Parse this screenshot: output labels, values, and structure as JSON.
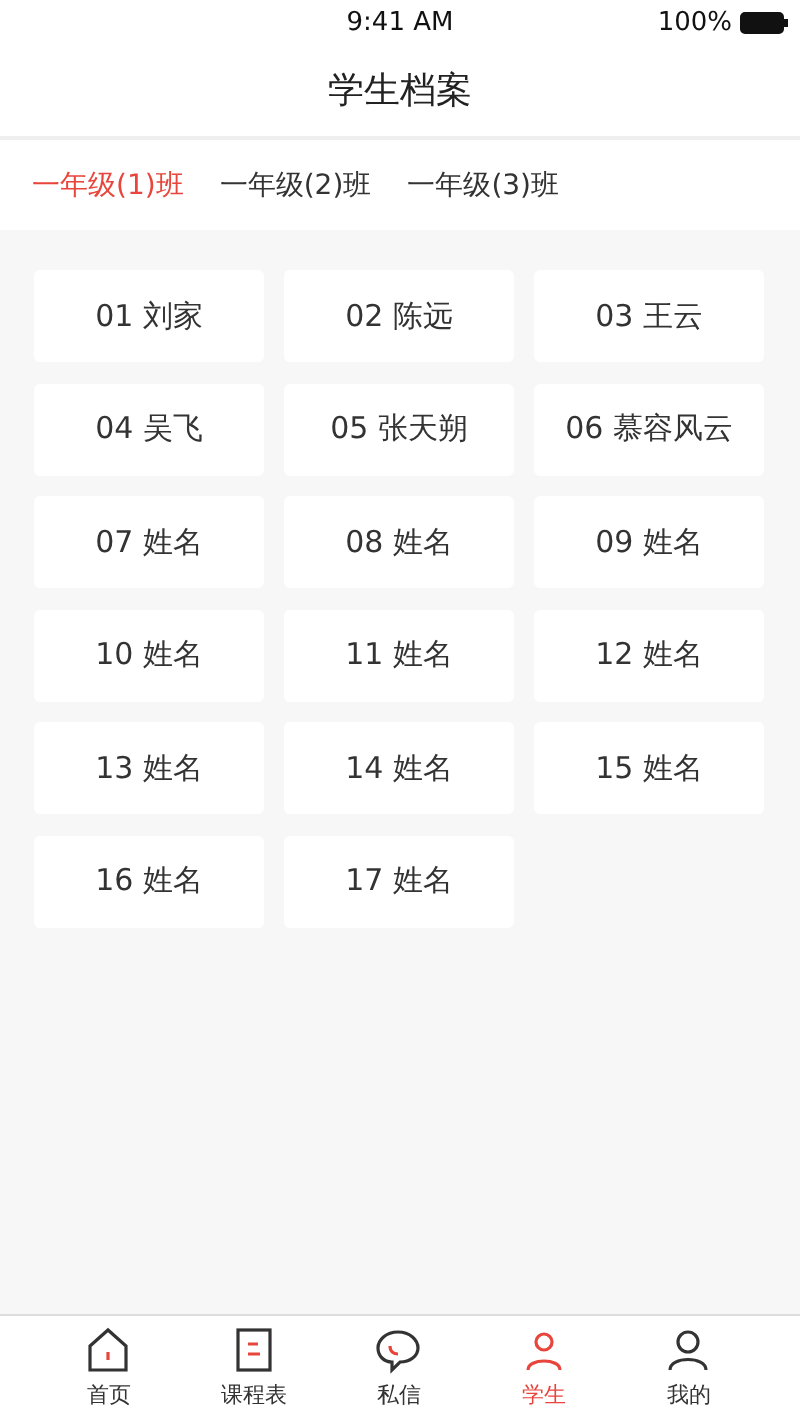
{
  "status_bar": {
    "time": "9:41 AM",
    "battery": "100%"
  },
  "title": "学生档案",
  "classes": [
    {
      "label": "一年级(1)班",
      "selected": true
    },
    {
      "label": "一年级(2)班",
      "selected": false
    },
    {
      "label": "一年级(3)班",
      "selected": false
    }
  ],
  "students": [
    "01 刘家",
    "02 陈远",
    "03 王云",
    "04 吴飞",
    "05 张天朔",
    "06 慕容风云",
    "07 姓名",
    "08 姓名",
    "09 姓名",
    "10 姓名",
    "11 姓名",
    "12 姓名",
    "13 姓名",
    "14 姓名",
    "15 姓名",
    "16 姓名",
    "17 姓名"
  ],
  "tab_bar": [
    {
      "kind": "home",
      "label": "首页",
      "selected": false
    },
    {
      "kind": "schedule",
      "label": "课程表",
      "selected": false
    },
    {
      "kind": "message",
      "label": "私信",
      "selected": false
    },
    {
      "kind": "student",
      "label": "学生",
      "selected": true
    },
    {
      "kind": "me",
      "label": "我的",
      "selected": false
    }
  ]
}
